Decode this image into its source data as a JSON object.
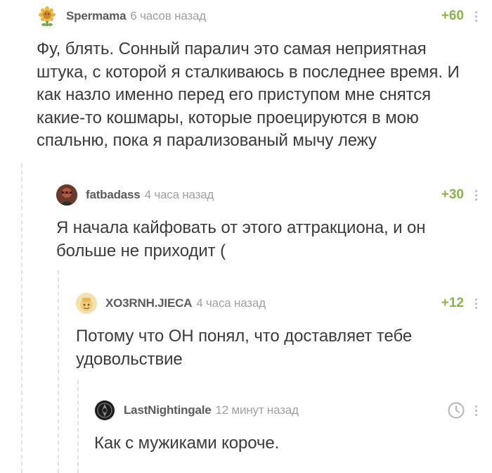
{
  "comments": [
    {
      "username": "Spermama",
      "time": "6 часов назад",
      "rating": "+60",
      "text": "Фу, блять. Сонный паралич это самая неприятная штука, с которой я сталкиваюсь в последнее время. И как назло именно перед его приступом мне снятся какие-то кошмары, которые проецируются в мою спальню, пока я парализованый мычу лежу",
      "avatar_icon": "sunflower-avatar-icon"
    },
    {
      "username": "fatbadass",
      "time": "4 часа назад",
      "rating": "+30",
      "text": "Я начала кайфовать от этого аттракциона, и он больше не приходит (",
      "avatar_icon": "character-avatar-icon"
    },
    {
      "username": "XO3RNH.JIECA",
      "time": "4 часа назад",
      "rating": "+12",
      "text": "Потому что ОН понял, что доставляет тебе удовольствие",
      "avatar_icon": "cartoon-avatar-icon"
    },
    {
      "username": "LastNightingale",
      "time": "12 минут назад",
      "text": "Как с мужиками короче.",
      "avatar_icon": "emblem-avatar-icon"
    }
  ],
  "colors": {
    "rating": "#8ab34a",
    "username": "#5b5b5b",
    "time": "#a0a0a0",
    "text": "#3b3b3b",
    "thread_line": "#e2e2e2"
  }
}
